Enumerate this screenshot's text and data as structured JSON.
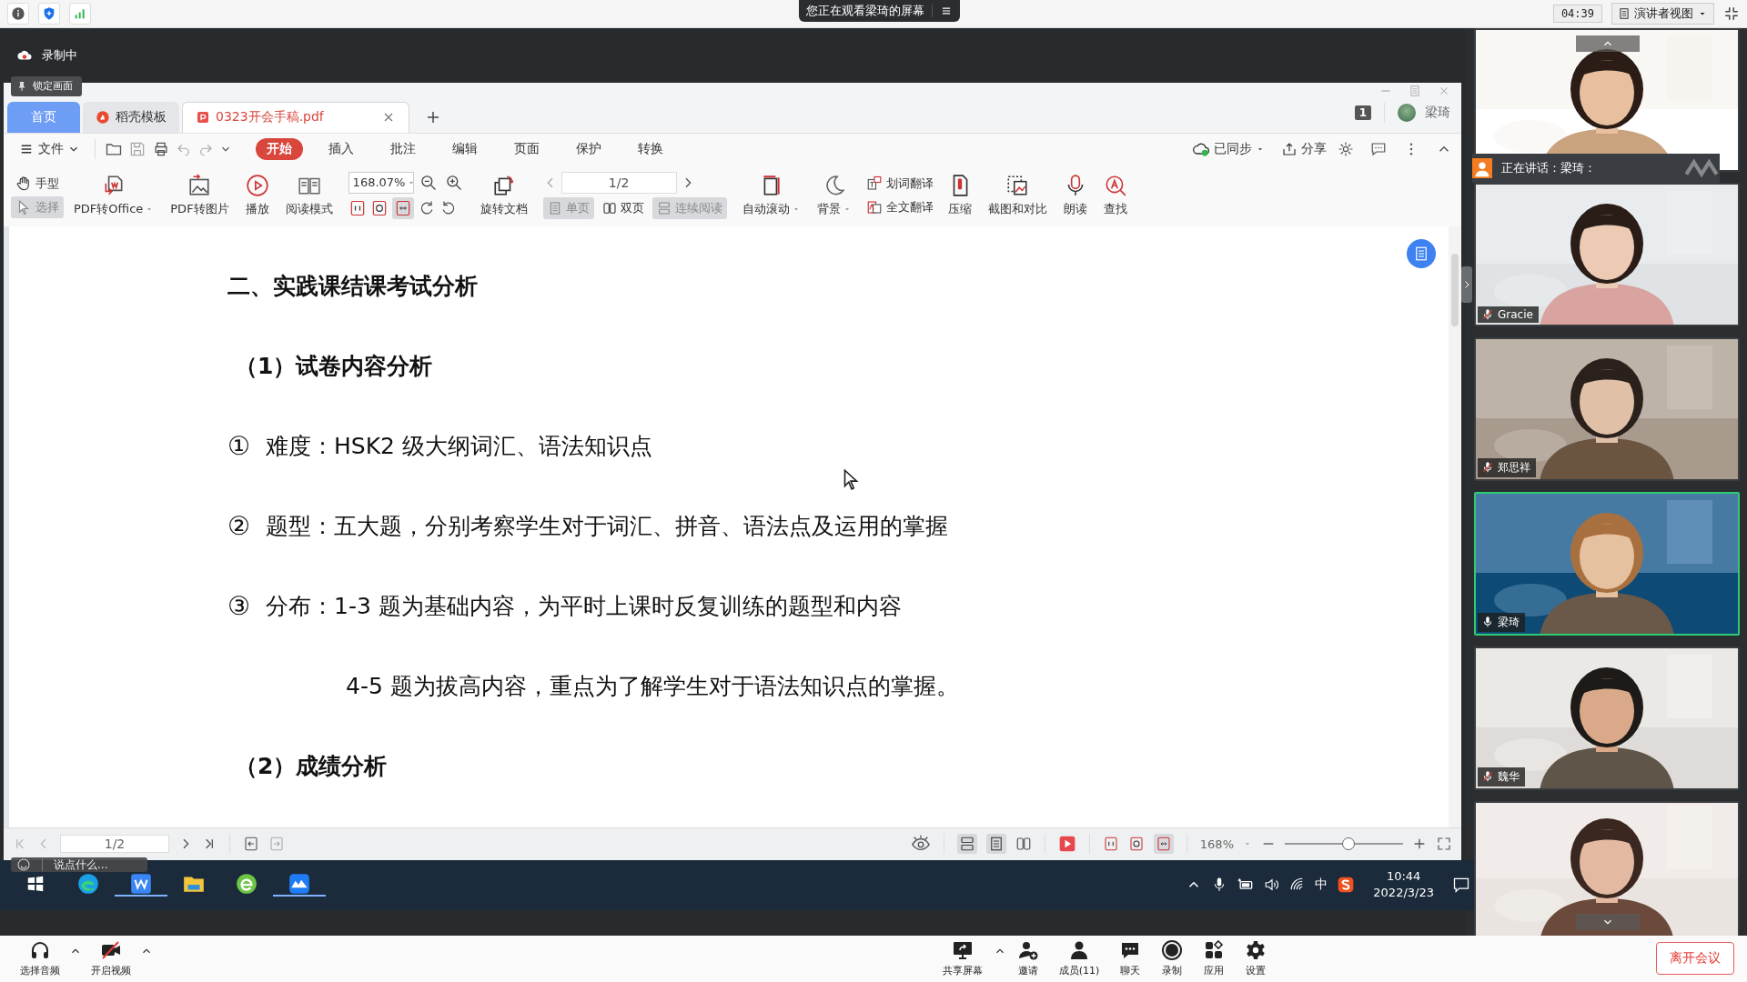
{
  "top_bar": {
    "viewing_notice": "您正在观看梁琦的屏幕",
    "timer": "04:39",
    "view_mode": "演讲者视图"
  },
  "shared_screen": {
    "recording": "录制中",
    "lock_tooltip": "锁定画面",
    "wps": {
      "tabs": [
        {
          "label": "首页",
          "kind": "home",
          "selected": false
        },
        {
          "label": "稻壳模板",
          "kind": "docer",
          "selected": false
        },
        {
          "label": "0323开会手稿.pdf",
          "kind": "pdf",
          "selected": true
        }
      ],
      "badge": "1",
      "user": "梁琦",
      "file_menu": "文件",
      "menu": [
        {
          "label": "开始",
          "selected": true
        },
        {
          "label": "插入",
          "selected": false
        },
        {
          "label": "批注",
          "selected": false
        },
        {
          "label": "编辑",
          "selected": false
        },
        {
          "label": "页面",
          "selected": false
        },
        {
          "label": "保护",
          "selected": false
        },
        {
          "label": "转换",
          "selected": false
        }
      ],
      "sync": "已同步",
      "share": "分享",
      "tools": [
        {
          "kind": "stack",
          "items": [
            {
              "label": "手型",
              "selected": false
            },
            {
              "label": "选择",
              "selected": true
            }
          ]
        },
        {
          "kind": "big",
          "label": "PDF转Office",
          "dropdown": true
        },
        {
          "kind": "big",
          "label": "PDF转图片",
          "dropdown": false
        },
        {
          "kind": "big",
          "label": "播放",
          "dropdown": false
        },
        {
          "kind": "big",
          "label": "阅读模式",
          "dropdown": false
        },
        {
          "kind": "zoom",
          "value": "168.07%"
        },
        {
          "kind": "big",
          "label": "旋转文档",
          "dropdown": false
        },
        {
          "kind": "pager",
          "value": "1/2",
          "modes": [
            {
              "label": "单页",
              "selected": true
            },
            {
              "label": "双页",
              "selected": false
            },
            {
              "label": "连续阅读",
              "selected": true
            }
          ]
        },
        {
          "kind": "big",
          "label": "自动滚动",
          "dropdown": true
        },
        {
          "kind": "big",
          "label": "背景",
          "dropdown": true
        },
        {
          "kind": "stack",
          "items": [
            {
              "label": "划词翻译",
              "selected": false
            },
            {
              "label": "全文翻译",
              "selected": false
            }
          ]
        },
        {
          "kind": "big",
          "label": "压缩",
          "dropdown": false
        },
        {
          "kind": "big",
          "label": "截图和对比",
          "dropdown": false
        },
        {
          "kind": "big",
          "label": "朗读",
          "dropdown": false
        },
        {
          "kind": "big",
          "label": "查找",
          "dropdown": false
        }
      ],
      "document": [
        {
          "kind": "heading",
          "text": "二、实践课结课考试分析"
        },
        {
          "kind": "subheading",
          "text": "（1）试卷内容分析"
        },
        {
          "kind": "item",
          "marker": "①",
          "label": "难度：",
          "text": "HSK2 级大纲词汇、语法知识点"
        },
        {
          "kind": "item",
          "marker": "②",
          "label": "题型：",
          "text": "五大题，分别考察学生对于词汇、拼音、语法点及运用的掌握"
        },
        {
          "kind": "item",
          "marker": "③",
          "label": "分布：",
          "text": "1-3 题为基础内容，为平时上课时反复训练的题型和内容"
        },
        {
          "kind": "continuation",
          "text": "4-5 题为拔高内容，重点为了解学生对于语法知识点的掌握。"
        },
        {
          "kind": "subheading",
          "text": "（2）成绩分析"
        }
      ],
      "status": {
        "page": "1/2",
        "zoom": "168%",
        "level": 0.54
      }
    },
    "chat_placeholder": "说点什么...",
    "taskbar": {
      "apps": [
        {
          "active": false
        },
        {
          "active": true
        },
        {
          "active": false
        },
        {
          "active": false
        },
        {
          "active": true
        }
      ],
      "ime": "中",
      "time": "10:44",
      "date": "2022/3/23"
    }
  },
  "video_panel": {
    "speaking_label": "正在讲话：梁琦：",
    "tiles": [
      {
        "kind": "slide"
      },
      {
        "kind": "camera",
        "name": "Gracie",
        "muted": true,
        "active": false
      },
      {
        "kind": "camera",
        "name": "郑思祥",
        "muted": true,
        "active": false
      },
      {
        "kind": "camera",
        "name": "梁琦",
        "muted": false,
        "active": true
      },
      {
        "kind": "camera",
        "name": "魏华",
        "muted": true,
        "active": false
      },
      {
        "kind": "camera"
      }
    ]
  },
  "meeting_bar": {
    "left": [
      {
        "label": "选择音频",
        "caret": true
      },
      {
        "label": "开启视频",
        "caret": true
      }
    ],
    "center": [
      {
        "label": "共享屏幕",
        "caret": true
      },
      {
        "label": "邀请",
        "caret": false
      },
      {
        "label": "成员(11)",
        "caret": false
      },
      {
        "label": "聊天",
        "caret": false
      },
      {
        "label": "录制",
        "caret": false
      },
      {
        "label": "应用",
        "caret": false
      },
      {
        "label": "设置",
        "caret": false
      }
    ],
    "leave": "离开会议"
  }
}
